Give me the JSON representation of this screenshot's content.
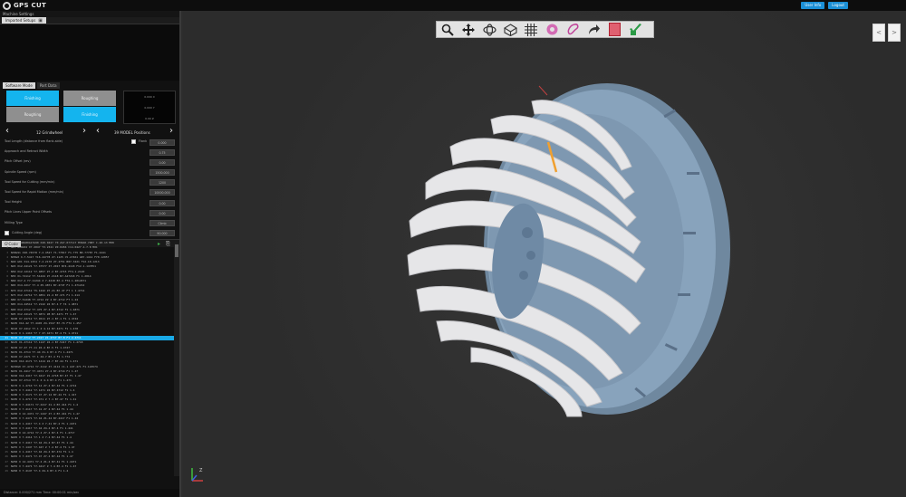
{
  "app": {
    "logo_text": "GPS CUT",
    "title_buttons": [
      "User Info",
      "Logout"
    ]
  },
  "left": {
    "menu_label": "Machine Settings",
    "top_tab": "Imported Setups",
    "tabs": [
      "Software Mode",
      "Part Data"
    ],
    "mode_buttons": {
      "top_left": "Finishing",
      "bottom_left": "Roughing",
      "top_right": "Roughing",
      "bottom_right": "Finishing"
    },
    "readout_lines": [
      "0.000 X",
      "0.000 Y",
      "0.00 Z"
    ],
    "nav_left_label": "12 Grindwheel",
    "nav_right_label": "39 MODEL Positions",
    "params": [
      {
        "label": "Tool Length (distance from flank-side)",
        "value": "0.000",
        "check_label": "Flank"
      },
      {
        "label": "Approach and Retract Width",
        "value": "0.75"
      },
      {
        "label": "Pitch Offset (rev)",
        "value": "0.00"
      },
      {
        "label": "Spindle Speed (rpm)",
        "value": "1500.000"
      },
      {
        "label": "Tool Speed for Cutting (mm/min)",
        "value": "1200"
      },
      {
        "label": "Tool Speed for Rapid Motion (mm/min)",
        "value": "10000.000"
      },
      {
        "label": "Tool Height",
        "value": "0.00"
      },
      {
        "label": "Pitch Lines Upper Point Offsets",
        "value": "0.00"
      },
      {
        "label": "Milling Type",
        "value": "Climb"
      },
      {
        "label": "Cutting Angle (deg)",
        "value": "90.000",
        "checkbox": true
      }
    ],
    "code_tab": "G-Code",
    "code_lines": [
      "N20G0G40G80G17G90 X20.0427 Y0 ZA7.077117 M30A0.7087 C-20.13 M08",
      "N25 G90G54 X7.2047 Y3.2341 Z0.8456 C14.0427 A-7.8 M01",
      "N30G91 X20.74578 Y-2.4527 Y1.77817 F1.775 B0.77787 F1.2441",
      "N35G0 X-7.5417 Y16.44778 Z7.1125 C5.27461 A87.1412 F70.12857",
      "N40 G01 X14.2254 Y-2.2170 Z7.4751 B87.3421 F12.10.1213",
      "N45 X12.44121 Y7.47577 Z7.2017 B74.4118 F12.1.147851",
      "N50 X12.12112 Y7.4857 Z7.2 B7.4715 FT4.1.2120",
      "N55 X1.74112 Y7.51424 Z7.2118 B7.A47218 F1 1.2014",
      "N60 X17.4 Y7.11244 Z 7.4218 B7.4 FT4.1.2014571",
      "N65 X14.4217 Y7.4 Z5.4871 B7.474T F1 1.471212",
      "N70 X12.47112 Y5.1242 Z7.21 B7.47 FT 1 1.4712",
      "N75 X12.14712 Y7.4851 Z1.4 B7.471 F1 1.214",
      "N80 X7.51248 Y7.4712 Z2 4 B7.4712 FT 1.24",
      "N85 X14.44512 Y7.2142 Z4 B7.4 F T4 1.4871",
      "N90 X12.4712 Y7.475 Z7.4 B7.4712 F1 1.4871",
      "N95 X12.44121 Y7.4871 Z8 B7.4471 FT 1.47",
      "N100 X7.44712 Y7.4511 Z7.1 B7.1 F1 1.4744",
      "N105 X14.42 Y7.4445 Z4.1547 B7.74 FT4 1.457",
      "N110 X7.4412 Y7.1 Z 4.12 B7.4471 F1 1.478",
      "N115 X 1.1410 Y7 7 Z7.4471 B7.4 F1 1.4711",
      "N120 X7.4712 Y7.2417 Z1.4717 B7.8 F1 2.4711",
      "N125 X1.47112 Y7.1147 Z4.1 B7.5417 F1 1.4718",
      "N130 X7.47 Y7.11 Z4.4 B7.5 F1 1.4747",
      "N135 X1.4714 Y7.44 Z1.4 B7.4 F1 1.4471",
      "N140 X7.4471 Y7 1 Z4.7 B7.4 F1 1.774",
      "N145 X12.4171 Y7.1414 Z4.7 B7.44 F1 1.471",
      "N150G0 X7.4712 Y7.4112 Z7.4112 C1.1 A47.471 F1.124574",
      "N155 X1.4417 Y7.4471 Z7.4 B7.4714 F1 1.47",
      "N160 X14.4417 Y7.4417 Z1.4718 B7.47 F1 1.47",
      "N165 X7.4714 Y7.1 Z 4.4 B7.4 F1 1.471",
      "N170 X 1.4710 Y7.14 Z7.4 B7.44 F1 1.4712",
      "N175 X 7.4412 Y7.1471 Z4 B7.4712 F1 1.4",
      "N180 X 7.4171 Y7.47 Z7.12 B7.44 F1 1.417",
      "N185 X 1.4717 Y7.471 Z 7.1 B7.47 F1 1.41",
      "N190 X 7.44171 Y7.4417 Z1.4 B7.414 F1 1.4",
      "N195 X 7.4117 Y7.41 Z7 4 B7.44 F1 1.44",
      "N200 X 12.4471 Y7.1447 Z7.4 B7.441 F1 1.47",
      "N205 X 7.4471 Y7.44 Z1.44 B7.4417 F1 1.44",
      "N210 X 1.4417 Y7.4 Z 7.41 B7.4 F1 1.4471",
      "N215 X 7.4417 Y7.44 Z4.4 B7.4 F1 1.441",
      "N220 X 14.4714 Y7.4 Z7.4 B7.4 F1 1.4717",
      "N225 X 7.4414 Y7.1 Z 7.4 B7.44 F1 1.4",
      "N230 X 7.4417 Y7.44 Z4.4 B7.47 F1 1.44",
      "N235 X 7.1447 Y7.447 Z 7.4 B7.4 F1 1.47",
      "N240 X 1.4417 Y7.44 Z4.4 B7.474 F1 1.4",
      "N245 X 7.4471 Y7.47 Z7.4 B7.44 F1 1.47",
      "N250 X 12.4471 Y7.4 Z1.4 B7.41 F1 1.4471",
      "N255 X 7.4471 Y7.4417 Z 7.4 B7.4 F1 1.47",
      "N260 X 7.4147 Y7.4 Z4.4 B7.4 F1 1.4"
    ],
    "selected_line_index": 20,
    "status_text": "Distance: 0.000/271 mm    Time: 00:00:01 min/sec"
  },
  "viewport": {
    "toolbar_icons": [
      "zoom-icon",
      "pan-icon",
      "rotate-icon",
      "view-cube-icon",
      "grid-icon",
      "gear-view-icon",
      "paint-icon",
      "redo-icon",
      "red-stop-icon",
      "checkmark-icon"
    ],
    "corner_buttons": [
      "<",
      ">"
    ],
    "axis_labels": [
      "X",
      "Y",
      "Z"
    ],
    "colors": {
      "tooth": "#e4e4e6",
      "body": "#7b97b1",
      "accent_blue": "#14b4ee",
      "tool_orange": "#f0a030"
    }
  }
}
